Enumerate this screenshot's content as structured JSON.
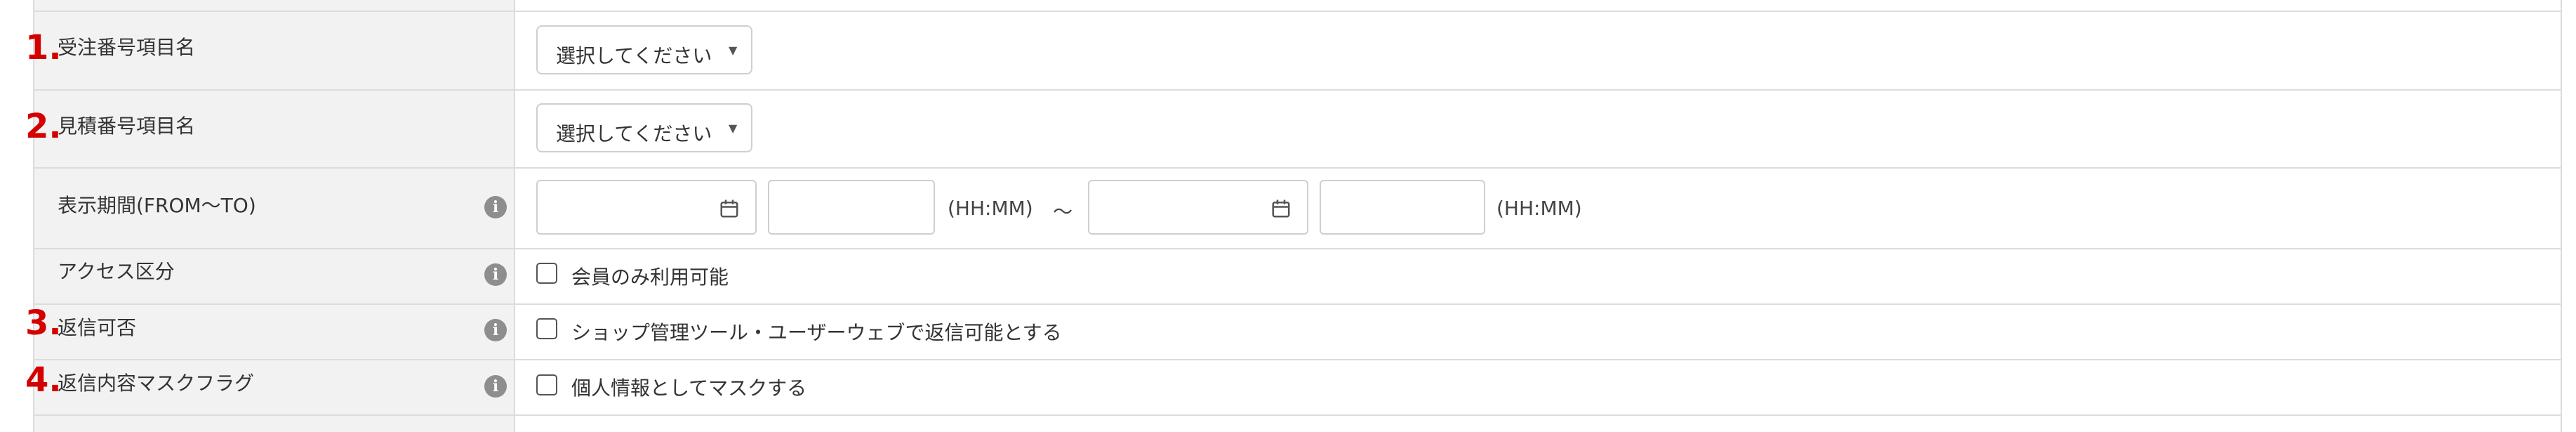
{
  "rows": [
    {
      "marker": "1.",
      "label": "受注番号項目名",
      "select_value": "選択してください"
    },
    {
      "marker": "2.",
      "label": "見積番号項目名",
      "select_value": "選択してください"
    },
    {
      "label": "表示期間(FROM～TO)",
      "from_unit": "(HH:MM)",
      "separator": "～",
      "to_unit": "(HH:MM)"
    },
    {
      "label": "アクセス区分",
      "checkbox_label": "会員のみ利用可能"
    },
    {
      "marker": "3.",
      "label": "返信可否",
      "checkbox_label": "ショップ管理ツール・ユーザーウェブで返信可能とする"
    },
    {
      "marker": "4.",
      "label": "返信内容マスクフラグ",
      "checkbox_label": "個人情報としてマスクする"
    }
  ],
  "icons": {
    "info": "info-circle-icon",
    "calendar": "calendar-icon",
    "caret": "caret-down-icon"
  },
  "colors": {
    "marker": "#d40000",
    "label_column_bg": "#f2f2f2",
    "border": "#dcdcdc"
  }
}
